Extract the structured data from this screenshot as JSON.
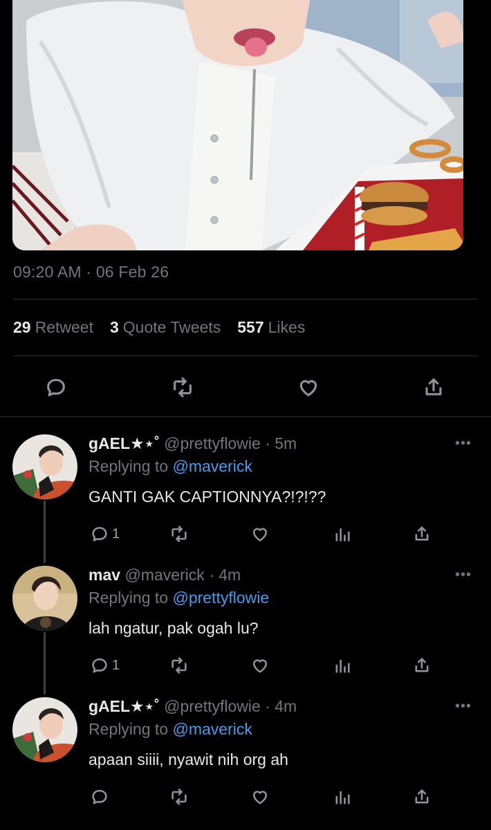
{
  "tweet": {
    "timestamp": "09:20 AM · 06 Feb 26",
    "stats": {
      "retweets_count": "29",
      "retweets_label": "Retweet",
      "quotes_count": "3",
      "quotes_label": "Quote Tweets",
      "likes_count": "557",
      "likes_label": "Likes"
    },
    "actions": [
      "reply-icon",
      "retweet-icon",
      "like-icon",
      "share-icon"
    ]
  },
  "replies": [
    {
      "name": "gAEL★⋆˚",
      "handle": "@prettyflowie",
      "dot": "·",
      "time": "5m",
      "replying_prefix": "Replying to",
      "replying_to": "@maverick",
      "text": "GANTI GAK CAPTIONNYA?!?!??",
      "reply_count": "1",
      "more": "•••"
    },
    {
      "name": "mav",
      "handle": "@maverick",
      "dot": "·",
      "time": "4m",
      "replying_prefix": "Replying to",
      "replying_to": "@prettyflowie",
      "text": "lah ngatur, pak ogah lu?",
      "reply_count": "1",
      "more": "•••"
    },
    {
      "name": "gAEL★⋆˚",
      "handle": "@prettyflowie",
      "dot": "·",
      "time": "4m",
      "replying_prefix": "Replying to",
      "replying_to": "@maverick",
      "text": "apaan siiii, nyawit nih org ah",
      "reply_count": "",
      "more": "•••"
    }
  ],
  "colors": {
    "background": "#000000",
    "text": "#e7e9ea",
    "muted": "#71767b",
    "link": "#4a9ceb",
    "divider": "#2f3336"
  }
}
